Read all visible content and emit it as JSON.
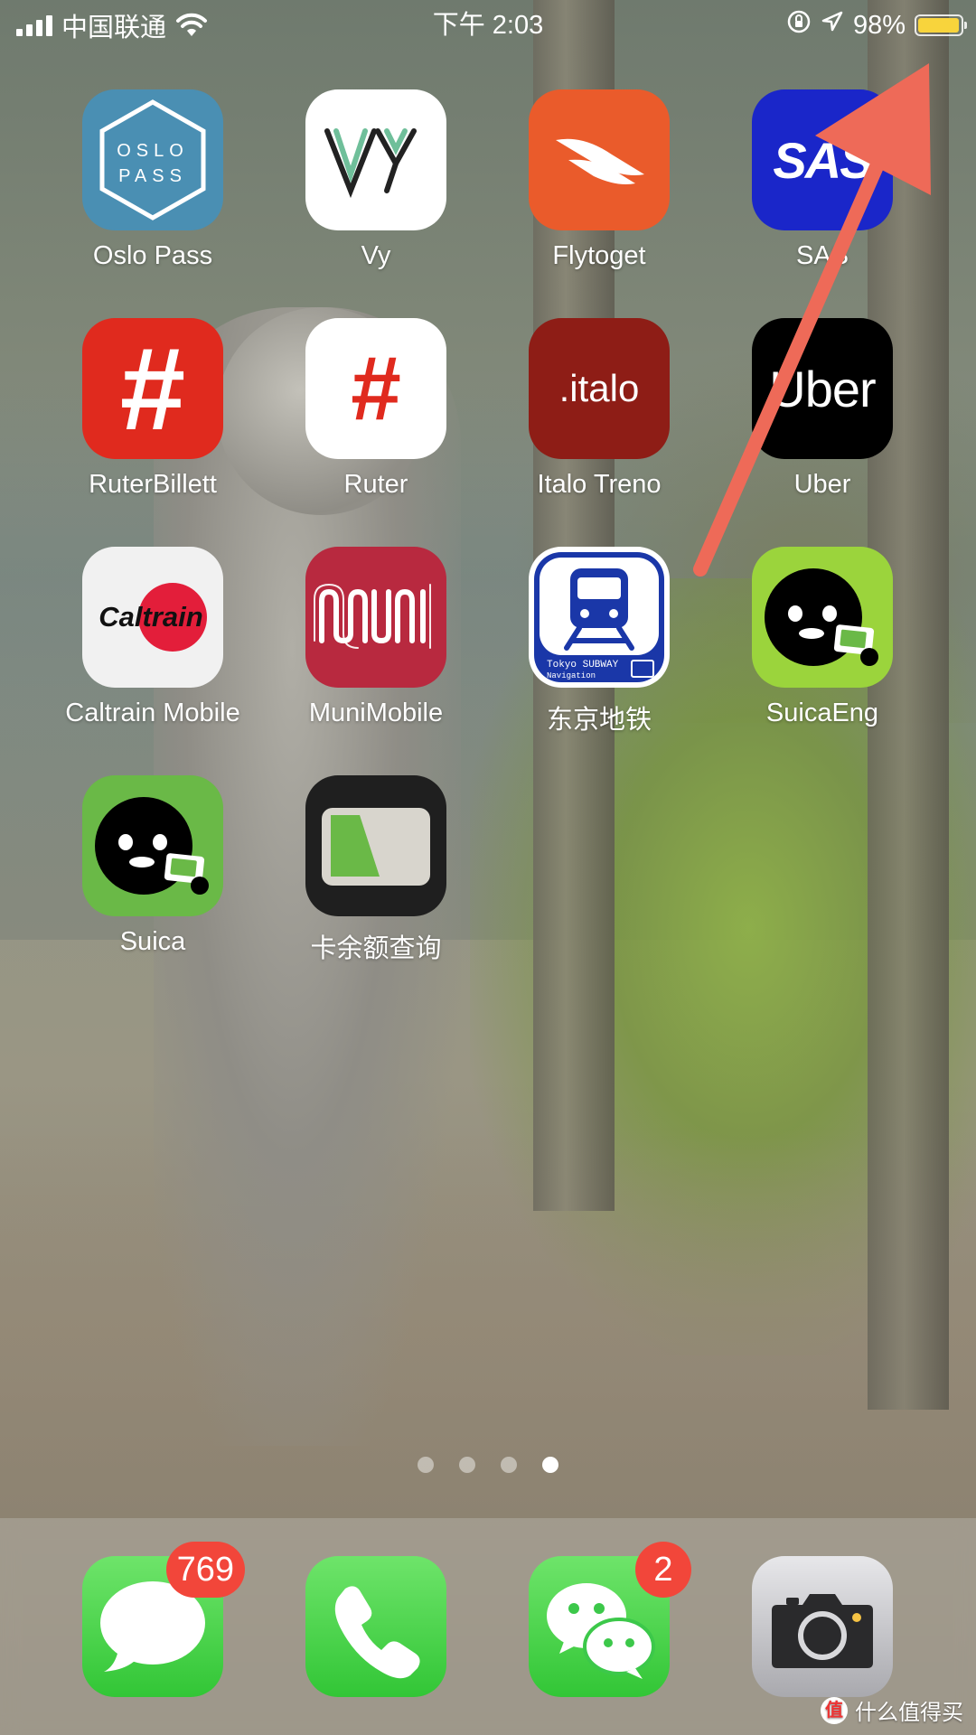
{
  "status_bar": {
    "carrier": "中国联通",
    "time": "下午 2:03",
    "battery_percent_text": "98%",
    "battery_level": 0.98,
    "signal_bars": 4,
    "icons": [
      "signal-icon",
      "wifi-icon",
      "orientation-lock-icon",
      "location-arrow-icon",
      "battery-icon"
    ]
  },
  "apps": [
    {
      "label": "Oslo Pass",
      "icon": "oslo-pass-icon",
      "icon_text": [
        "OSLO",
        "PASS"
      ]
    },
    {
      "label": "Vy",
      "icon": "vy-icon"
    },
    {
      "label": "Flytoget",
      "icon": "flytoget-icon"
    },
    {
      "label": "SAS",
      "icon": "sas-icon",
      "icon_text": "SAS"
    },
    {
      "label": "RuterBillett",
      "icon": "ruterbillett-icon",
      "icon_text": "#"
    },
    {
      "label": "Ruter",
      "icon": "ruter-icon",
      "icon_text": "#"
    },
    {
      "label": "Italo Treno",
      "icon": "italo-icon",
      "icon_text": ".italo"
    },
    {
      "label": "Uber",
      "icon": "uber-icon",
      "icon_text": "Uber"
    },
    {
      "label": "Caltrain Mobile",
      "icon": "caltrain-icon",
      "icon_text": "Caltrain"
    },
    {
      "label": "MuniMobile",
      "icon": "muni-icon",
      "icon_text": "MUNI"
    },
    {
      "label": "东京地铁",
      "icon": "tokyo-subway-icon",
      "icon_text": [
        "Tokyo SUBWAY",
        "Navigation"
      ]
    },
    {
      "label": "SuicaEng",
      "icon": "suica-eng-icon"
    },
    {
      "label": "Suica",
      "icon": "suica-icon"
    },
    {
      "label": "卡余额查询",
      "icon": "card-balance-icon"
    }
  ],
  "page_dots": {
    "count": 4,
    "active_index": 3
  },
  "dock": [
    {
      "name": "Messages",
      "icon": "messages-icon",
      "badge": "769"
    },
    {
      "name": "Phone",
      "icon": "phone-icon",
      "badge": ""
    },
    {
      "name": "WeChat",
      "icon": "wechat-icon",
      "badge": "2"
    },
    {
      "name": "Camera",
      "icon": "camera-icon",
      "badge": ""
    }
  ],
  "annotation": {
    "type": "arrow",
    "color": "#ee6a58",
    "points_to": "battery-indicator"
  },
  "watermark": {
    "text": "什么值得买",
    "logo": "值"
  },
  "colors": {
    "oslo_pass": "#4a8fb3",
    "flytoget": "#ea5b2b",
    "sas": "#1a26c9",
    "ruterbillett": "#e02a1e",
    "italo": "#8e1d16",
    "uber": "#000000",
    "muni": "#b8293f",
    "tokyo_subway": "#1a37a8",
    "suica_eng": "#9bd43c",
    "suica": "#6ab947",
    "badge": "#f2463a",
    "battery_fill": "#f8d43c"
  }
}
